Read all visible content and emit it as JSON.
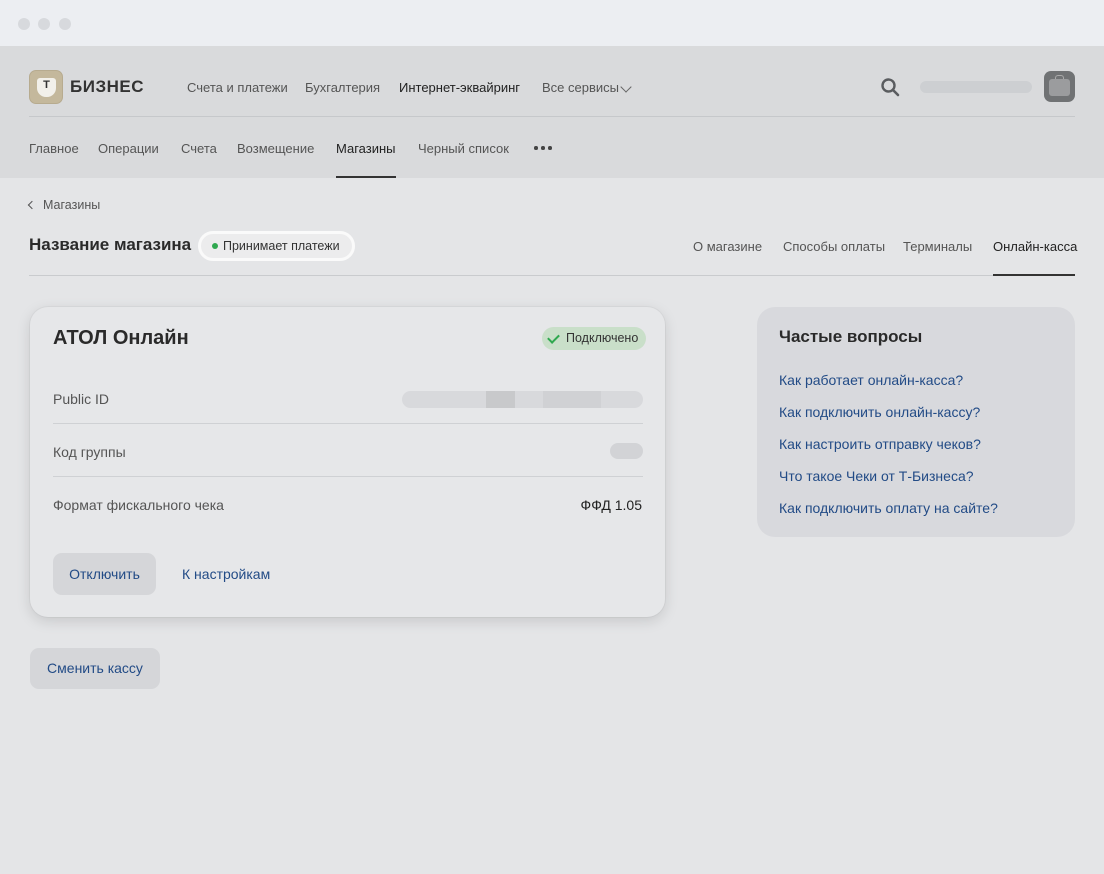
{
  "header": {
    "brand": "БИЗНЕС",
    "logo_letter": "Т",
    "nav": [
      "Счета и платежи",
      "Бухгалтерия",
      "Интернет-эквайринг",
      "Все сервисы"
    ],
    "active_nav": "Интернет-эквайринг"
  },
  "subnav": {
    "items": [
      "Главное",
      "Операции",
      "Счета",
      "Возмещение",
      "Магазины",
      "Черный список"
    ],
    "active": "Магазины"
  },
  "breadcrumb": "Магазины",
  "store": {
    "title": "Название магазина",
    "status": "Принимает платежи",
    "tabs": [
      "О магазине",
      "Способы оплаты",
      "Терминалы",
      "Онлайн-касса"
    ],
    "active_tab": "Онлайн-касса"
  },
  "card": {
    "title": "АТОЛ Онлайн",
    "status": "Подключено",
    "rows": [
      {
        "label": "Public ID",
        "value": ""
      },
      {
        "label": "Код группы",
        "value": ""
      },
      {
        "label": "Формат фискального чека",
        "value": "ФФД 1.05"
      }
    ],
    "disconnect": "Отключить",
    "settings": "К настройкам"
  },
  "change_button": "Сменить кассу",
  "faq": {
    "title": "Частые вопросы",
    "links": [
      "Как работает онлайн-касса?",
      "Как подключить онлайн-кассу?",
      "Как настроить отправку чеков?",
      "Что такое Чеки от Т-Бизнеса?",
      "Как подключить оплату на сайте?"
    ]
  },
  "colors": {
    "link": "#224b86",
    "success": "#2fa84f",
    "success_bg": "#c9dfc9",
    "header_bg": "#d9dadc",
    "page_bg": "#e4e5e7"
  },
  "icons": [
    "search-icon",
    "chevron-down-icon",
    "more-icon",
    "check-icon",
    "back-arrow-icon",
    "avatar-icon"
  ]
}
